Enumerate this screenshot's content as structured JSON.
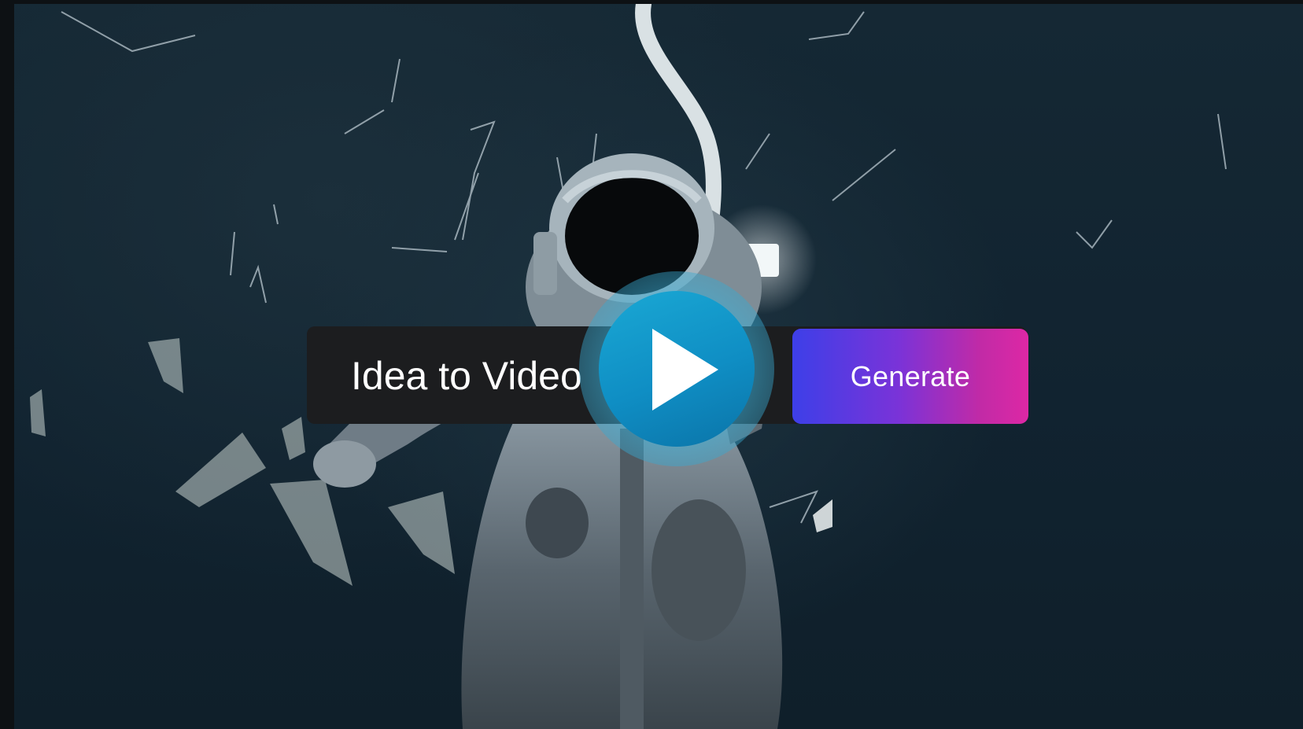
{
  "prompt": {
    "text": "Idea to Video"
  },
  "actions": {
    "generate_label": "Generate"
  },
  "icons": {
    "play": "play-icon"
  },
  "colors": {
    "background": "#132733",
    "prompt_bar": "#1c1d1f",
    "generate_gradient_start": "#3d3fe8",
    "generate_gradient_end": "#dd28a5",
    "play_button": "#1aa8d4"
  }
}
